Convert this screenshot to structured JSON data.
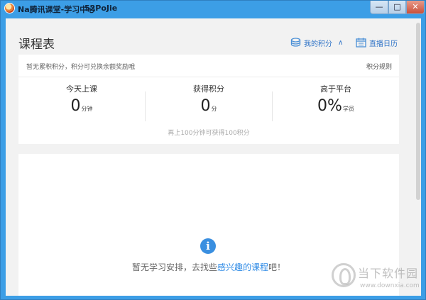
{
  "window": {
    "title": "Na腾讯课堂-学习中心",
    "title_extra": "52PoJie",
    "min_symbol": "—",
    "max_symbol": "□",
    "close_symbol": "✕",
    "icon": "app-logo-icon"
  },
  "header": {
    "title": "课程表",
    "points_link": "我的积分",
    "points_icon": "coins-icon",
    "points_chevron": "∧",
    "live_link": "直播日历",
    "live_icon": "calendar-icon"
  },
  "stats_card": {
    "note": "暂无累积积分，积分可兑换余额奖励哦",
    "rules_link": "积分规则",
    "stats": [
      {
        "label": "今天上课",
        "value": "0",
        "unit": "分钟"
      },
      {
        "label": "获得积分",
        "value": "0",
        "unit": "分"
      },
      {
        "label": "高于平台",
        "value": "0%",
        "unit": "学员"
      }
    ],
    "footer": "再上100分钟可获得100积分"
  },
  "schedule": {
    "icon": "info-icon",
    "icon_glyph": "i",
    "msg_prefix": "暂无学习安排，去找些",
    "msg_link": "感兴趣的课程",
    "msg_suffix": "吧！"
  },
  "watermark": {
    "name": "当下软件园",
    "url": "www.downxia.com"
  },
  "colors": {
    "title_bar": "#3c9ee6",
    "accent": "#2f73c7",
    "link_highlight": "#2f8be6",
    "background": "#f2f2f2"
  }
}
